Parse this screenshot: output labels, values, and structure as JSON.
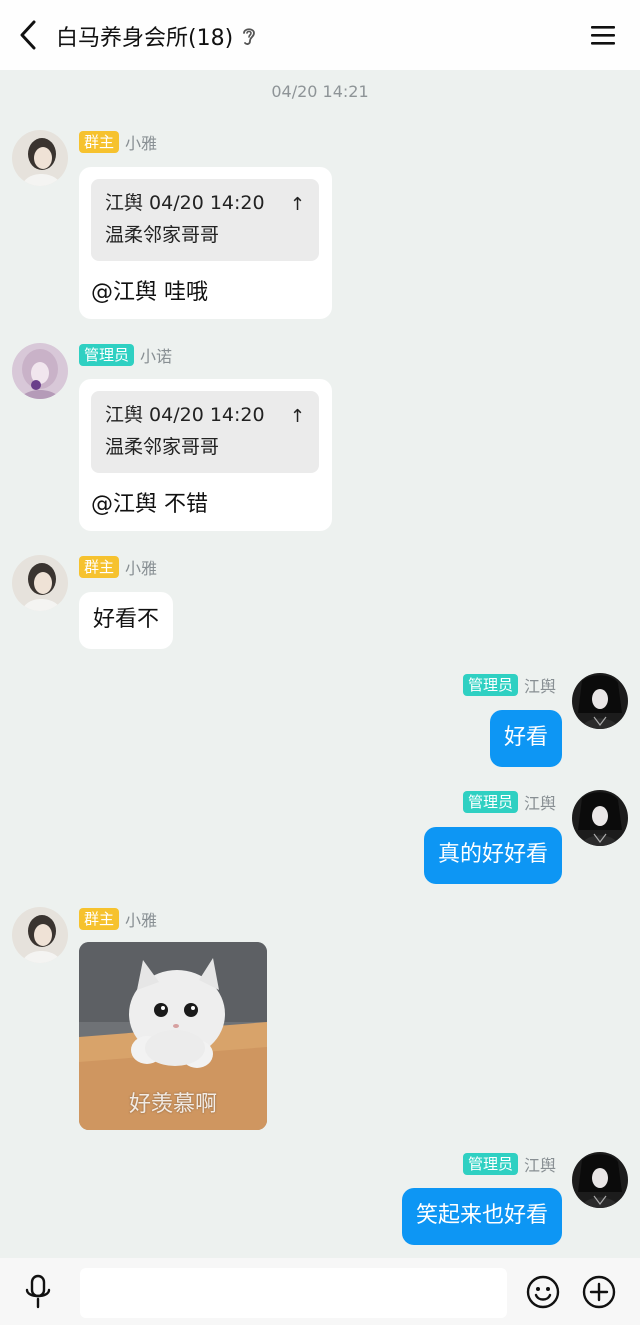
{
  "header": {
    "title": "白马养身会所(18)",
    "back_icon": "chevron-left-icon",
    "ear_icon": "ear-icon",
    "menu_icon": "menu-icon"
  },
  "messages": [
    {
      "type": "time",
      "text": "04/20 14:21"
    },
    {
      "side": "left",
      "badge": "群主",
      "badge_role": "owner",
      "nick": "小雅",
      "quote": {
        "author_time": "江舆 04/20 14:20",
        "text": "温柔邻家哥哥",
        "arrow": "↑"
      },
      "text": "@江舆 哇哦"
    },
    {
      "side": "left",
      "badge": "管理员",
      "badge_role": "admin",
      "nick": "小诺",
      "quote": {
        "author_time": "江舆 04/20 14:20",
        "text": "温柔邻家哥哥",
        "arrow": "↑"
      },
      "text": "@江舆 不错"
    },
    {
      "side": "left",
      "badge": "群主",
      "badge_role": "owner",
      "nick": "小雅",
      "text": "好看不"
    },
    {
      "side": "right",
      "badge": "管理员",
      "badge_role": "admin",
      "nick": "江舆",
      "text": "好看"
    },
    {
      "side": "right",
      "badge": "管理员",
      "badge_role": "admin",
      "nick": "江舆",
      "text": "真的好好看"
    },
    {
      "side": "left",
      "badge": "群主",
      "badge_role": "owner",
      "nick": "小雅",
      "image_caption": "好羡慕啊"
    },
    {
      "side": "right",
      "badge": "管理员",
      "badge_role": "admin",
      "nick": "江舆",
      "text": "笑起来也好看"
    }
  ],
  "input": {
    "placeholder": "",
    "value": ""
  },
  "colors": {
    "background": "#edf1ef",
    "out_bubble": "#0d96f4",
    "owner_badge": "#f6c22e",
    "admin_badge": "#2fd0c2"
  },
  "bottom_icons": [
    "microphone-icon",
    "emoji-icon",
    "plus-icon"
  ]
}
